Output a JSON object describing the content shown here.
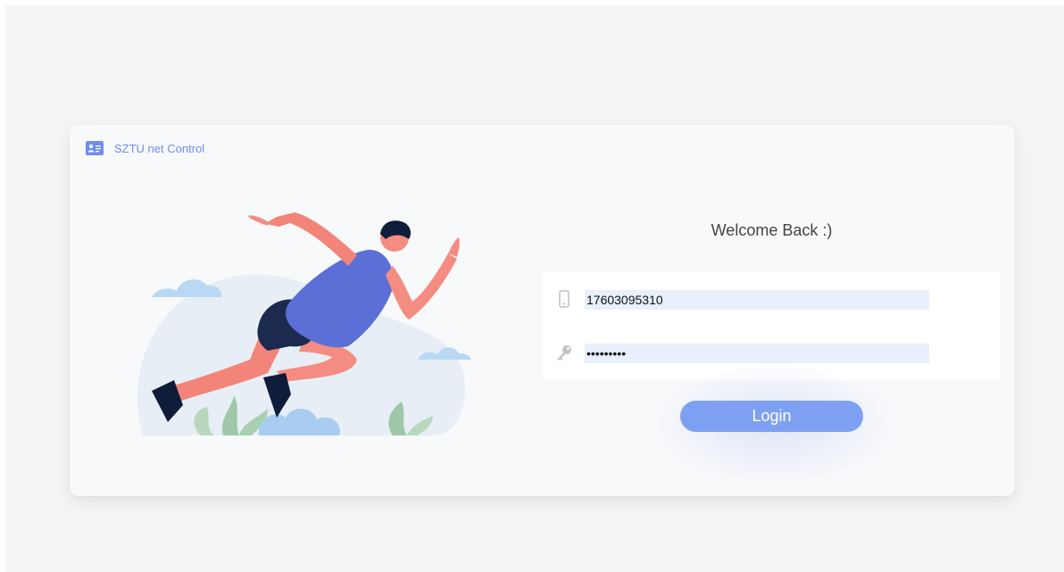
{
  "brand": {
    "title": "SZTU net Control",
    "icon": "id-card-icon"
  },
  "login_form": {
    "heading": "Welcome Back :)",
    "account": {
      "icon": "phone-icon",
      "value": "17603095310"
    },
    "password": {
      "icon": "key-icon",
      "value": "•••••••••"
    },
    "login_label": "Login"
  },
  "colors": {
    "accent": "#7ea0f3",
    "brand_text": "#6f8cf0",
    "autofill_bg": "#e8f0fe",
    "page_bg": "#f5f5f5",
    "card_bg": "#f8f9fb"
  }
}
